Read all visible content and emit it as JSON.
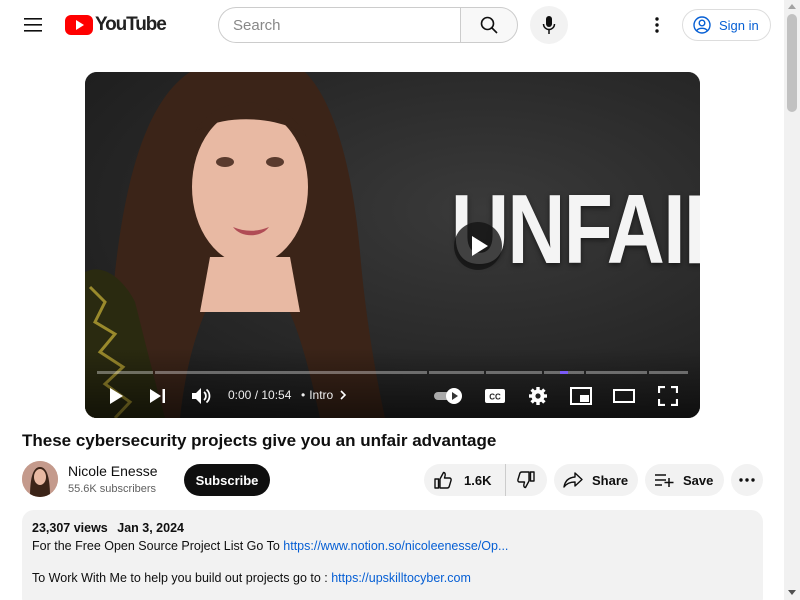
{
  "header": {
    "logo_text": "YouTube",
    "search_placeholder": "Search",
    "signin_label": "Sign in"
  },
  "player": {
    "overlay_text": "UNFAIR",
    "time": "0:00 / 10:54",
    "chapter": "Intro"
  },
  "video": {
    "title": "These cybersecurity projects give you an unfair advantage"
  },
  "channel": {
    "name": "Nicole Enesse",
    "subscribers": "55.6K subscribers",
    "subscribe_label": "Subscribe"
  },
  "actions": {
    "likes": "1.6K",
    "share_label": "Share",
    "save_label": "Save"
  },
  "description": {
    "views": "23,307 views",
    "date": "Jan 3, 2024",
    "line1_text": "For the Free Open Source Project List Go To ",
    "line1_link": "https://www.notion.so/nicoleenesse/Op...",
    "line2_text": "To Work With Me to help you build out projects go to : ",
    "line2_link": "https://upskilltocyber.com"
  },
  "colors": {
    "brand_red": "#ff0000",
    "link_blue": "#065fd4",
    "progress_accent": "#7a5af8"
  }
}
